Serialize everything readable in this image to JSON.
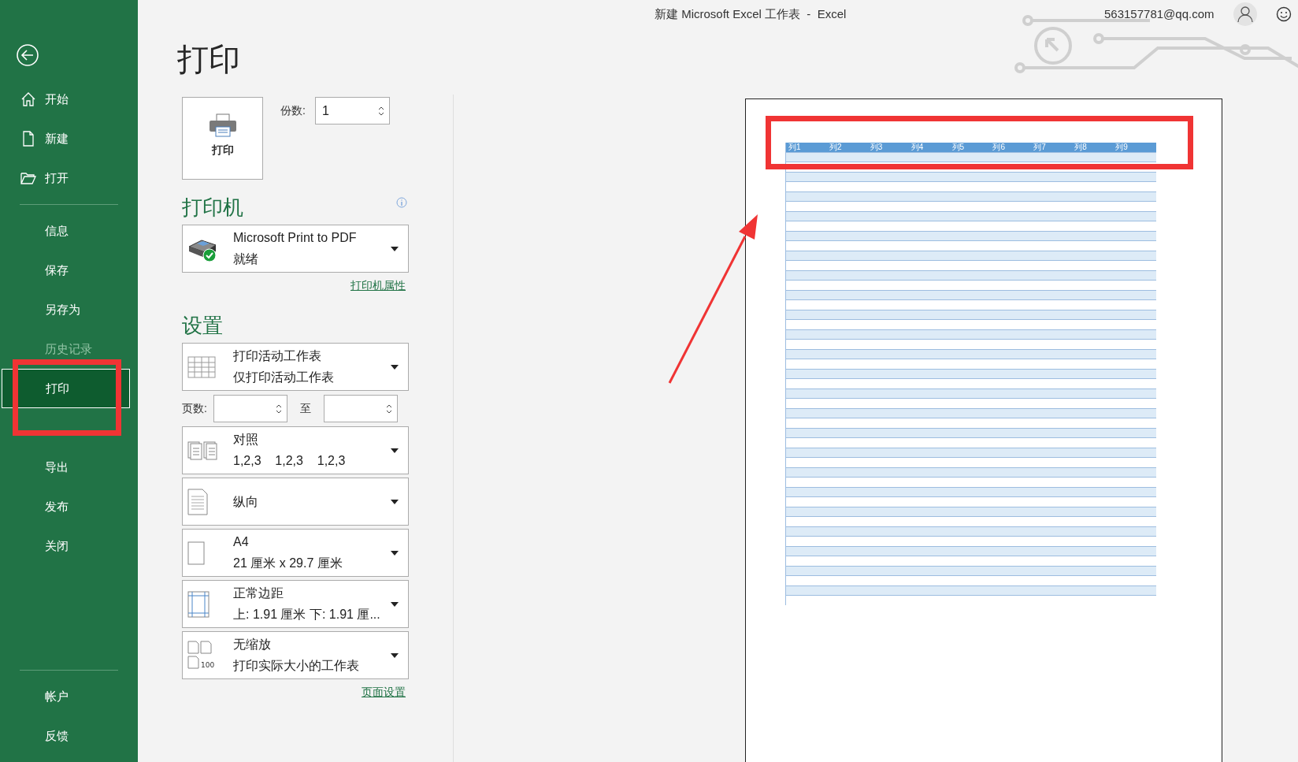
{
  "window": {
    "title": "新建 Microsoft Excel 工作表  -  Excel",
    "account": "563157781@qq.com"
  },
  "sidebar": {
    "top_items": [
      {
        "label": "开始",
        "selected": false,
        "disabled": false
      },
      {
        "label": "新建",
        "selected": false,
        "disabled": false
      },
      {
        "label": "打开",
        "selected": false,
        "disabled": false
      }
    ],
    "main_items": [
      {
        "label": "信息",
        "selected": false,
        "disabled": false
      },
      {
        "label": "保存",
        "selected": false,
        "disabled": false
      },
      {
        "label": "另存为",
        "selected": false,
        "disabled": false
      },
      {
        "label": "历史记录",
        "selected": false,
        "disabled": true
      },
      {
        "label": "打印",
        "selected": true,
        "disabled": false
      },
      {
        "label": "导出",
        "selected": false,
        "disabled": false
      },
      {
        "label": "发布",
        "selected": false,
        "disabled": false
      },
      {
        "label": "关闭",
        "selected": false,
        "disabled": false
      }
    ],
    "bottom_items": [
      {
        "label": "帐户",
        "selected": false,
        "disabled": false
      },
      {
        "label": "反馈",
        "selected": false,
        "disabled": false
      }
    ]
  },
  "page_title": "打印",
  "print_button": "打印",
  "copies": {
    "label": "份数:",
    "value": "1"
  },
  "printer": {
    "heading": "打印机",
    "name": "Microsoft Print to PDF",
    "status": "就绪",
    "link": "打印机属性"
  },
  "settings": {
    "heading": "设置",
    "pages": {
      "label": "页数:",
      "to": "至"
    },
    "dropdowns": [
      {
        "kind": "sheet",
        "primary": "打印活动工作表",
        "secondary": "仅打印活动工作表"
      },
      {
        "kind": "collate",
        "primary": "对照",
        "secondary": "1,2,3    1,2,3    1,2,3"
      },
      {
        "kind": "portrait",
        "primary": "纵向"
      },
      {
        "kind": "paper",
        "primary": "A4",
        "secondary": "21 厘米 x 29.7 厘米"
      },
      {
        "kind": "margins",
        "primary": "正常边距",
        "secondary": "上: 1.91 厘米 下: 1.91 厘..."
      },
      {
        "kind": "scaling",
        "primary": "无缩放",
        "secondary": "打印实际大小的工作表",
        "icon_label": "100"
      }
    ],
    "link": "页面设置"
  },
  "preview": {
    "columns": [
      "列1",
      "列2",
      "列3",
      "列4",
      "列5",
      "列6",
      "列7",
      "列8",
      "列9"
    ]
  }
}
